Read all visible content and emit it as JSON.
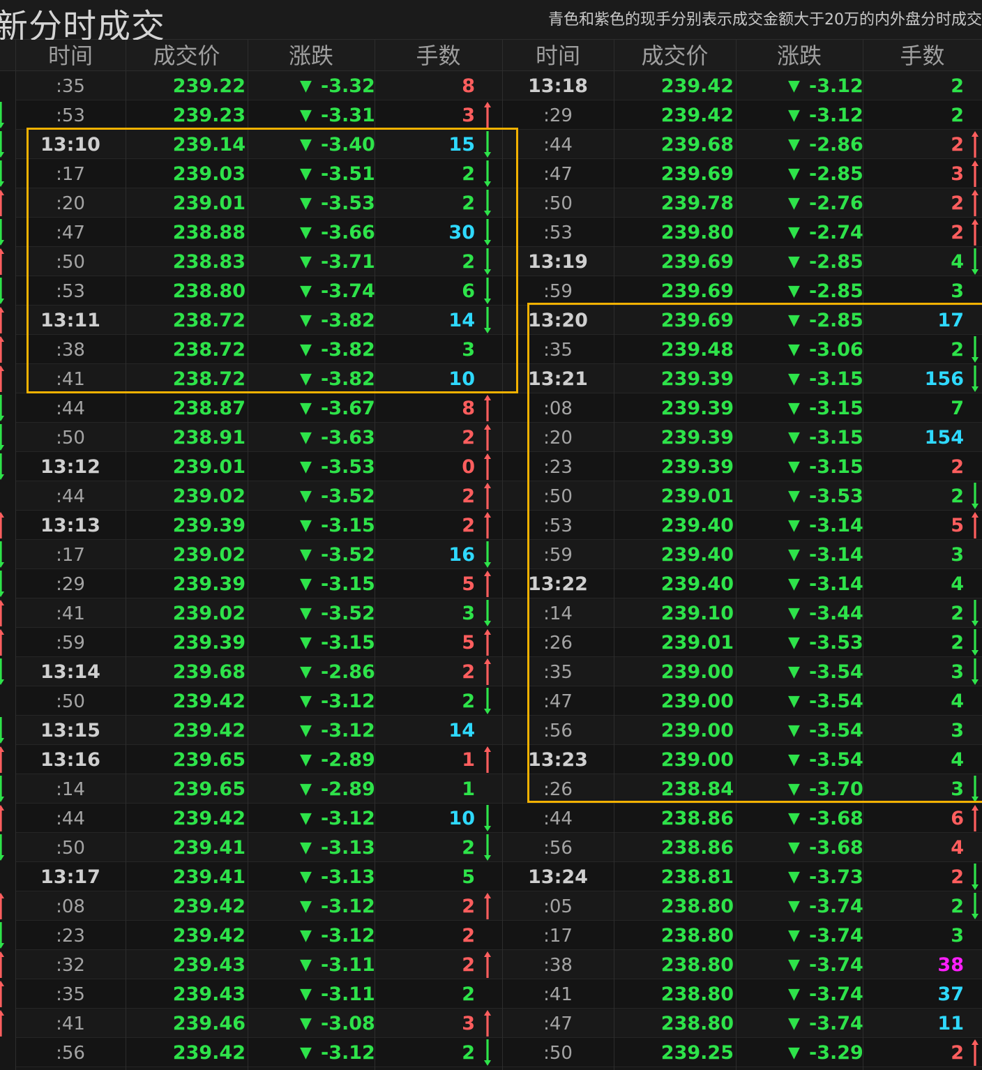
{
  "header": {
    "title": "新分时成交",
    "note": "青色和紫色的现手分别表示成交金额大于20万的内外盘分时成交"
  },
  "columns": [
    "时间",
    "成交价",
    "涨跌",
    "手数"
  ],
  "colors": {
    "price": "#2ee34a",
    "up": "#ff5e5e",
    "down": "#2ee34a",
    "large_buy": "#2fd9ff",
    "large_sell": "#ff1fff",
    "neutral": "#2ee34a",
    "highlight_box": "#f2b100"
  },
  "left_edge_markers": [
    "",
    "d",
    "d",
    "d",
    "u",
    "d",
    "u",
    "d",
    "u",
    "u",
    "u",
    "d",
    "d",
    "d",
    "",
    "u",
    "d",
    "d",
    "u",
    "u",
    "d",
    "",
    "d",
    "u",
    "d",
    "u",
    "d",
    "",
    "u",
    "d",
    "u",
    "u",
    "u",
    ""
  ],
  "left_rows": [
    {
      "time": ":35",
      "price": "239.22",
      "change": "-3.32",
      "volume": "8",
      "color": "up",
      "arrow": ""
    },
    {
      "time": ":53",
      "price": "239.23",
      "change": "-3.31",
      "volume": "3",
      "color": "up",
      "arrow": "up"
    },
    {
      "time": "13:10",
      "price": "239.14",
      "change": "-3.40",
      "volume": "15",
      "color": "large_buy",
      "arrow": "down"
    },
    {
      "time": ":17",
      "price": "239.03",
      "change": "-3.51",
      "volume": "2",
      "color": "down",
      "arrow": "down"
    },
    {
      "time": ":20",
      "price": "239.01",
      "change": "-3.53",
      "volume": "2",
      "color": "down",
      "arrow": "down"
    },
    {
      "time": ":47",
      "price": "238.88",
      "change": "-3.66",
      "volume": "30",
      "color": "large_buy",
      "arrow": "down"
    },
    {
      "time": ":50",
      "price": "238.83",
      "change": "-3.71",
      "volume": "2",
      "color": "down",
      "arrow": "down"
    },
    {
      "time": ":53",
      "price": "238.80",
      "change": "-3.74",
      "volume": "6",
      "color": "down",
      "arrow": "down"
    },
    {
      "time": "13:11",
      "price": "238.72",
      "change": "-3.82",
      "volume": "14",
      "color": "large_buy",
      "arrow": "down"
    },
    {
      "time": ":38",
      "price": "238.72",
      "change": "-3.82",
      "volume": "3",
      "color": "neutral",
      "arrow": ""
    },
    {
      "time": ":41",
      "price": "238.72",
      "change": "-3.82",
      "volume": "10",
      "color": "large_buy",
      "arrow": ""
    },
    {
      "time": ":44",
      "price": "238.87",
      "change": "-3.67",
      "volume": "8",
      "color": "up",
      "arrow": "up"
    },
    {
      "time": ":50",
      "price": "238.91",
      "change": "-3.63",
      "volume": "2",
      "color": "up",
      "arrow": "up"
    },
    {
      "time": "13:12",
      "price": "239.01",
      "change": "-3.53",
      "volume": "0",
      "color": "up",
      "arrow": "up"
    },
    {
      "time": ":44",
      "price": "239.02",
      "change": "-3.52",
      "volume": "2",
      "color": "up",
      "arrow": "up"
    },
    {
      "time": "13:13",
      "price": "239.39",
      "change": "-3.15",
      "volume": "2",
      "color": "up",
      "arrow": "up"
    },
    {
      "time": ":17",
      "price": "239.02",
      "change": "-3.52",
      "volume": "16",
      "color": "large_buy",
      "arrow": "down"
    },
    {
      "time": ":29",
      "price": "239.39",
      "change": "-3.15",
      "volume": "5",
      "color": "up",
      "arrow": "up"
    },
    {
      "time": ":41",
      "price": "239.02",
      "change": "-3.52",
      "volume": "3",
      "color": "down",
      "arrow": "down"
    },
    {
      "time": ":59",
      "price": "239.39",
      "change": "-3.15",
      "volume": "5",
      "color": "up",
      "arrow": "up"
    },
    {
      "time": "13:14",
      "price": "239.68",
      "change": "-2.86",
      "volume": "2",
      "color": "up",
      "arrow": "up"
    },
    {
      "time": ":50",
      "price": "239.42",
      "change": "-3.12",
      "volume": "2",
      "color": "down",
      "arrow": "down"
    },
    {
      "time": "13:15",
      "price": "239.42",
      "change": "-3.12",
      "volume": "14",
      "color": "large_buy",
      "arrow": ""
    },
    {
      "time": "13:16",
      "price": "239.65",
      "change": "-2.89",
      "volume": "1",
      "color": "up",
      "arrow": "up"
    },
    {
      "time": ":14",
      "price": "239.65",
      "change": "-2.89",
      "volume": "1",
      "color": "neutral",
      "arrow": ""
    },
    {
      "time": ":44",
      "price": "239.42",
      "change": "-3.12",
      "volume": "10",
      "color": "large_buy",
      "arrow": "down"
    },
    {
      "time": ":50",
      "price": "239.41",
      "change": "-3.13",
      "volume": "2",
      "color": "down",
      "arrow": "down"
    },
    {
      "time": "13:17",
      "price": "239.41",
      "change": "-3.13",
      "volume": "5",
      "color": "neutral",
      "arrow": ""
    },
    {
      "time": ":08",
      "price": "239.42",
      "change": "-3.12",
      "volume": "2",
      "color": "up",
      "arrow": "up"
    },
    {
      "time": ":23",
      "price": "239.42",
      "change": "-3.12",
      "volume": "2",
      "color": "up",
      "arrow": ""
    },
    {
      "time": ":32",
      "price": "239.43",
      "change": "-3.11",
      "volume": "2",
      "color": "up",
      "arrow": "up"
    },
    {
      "time": ":35",
      "price": "239.43",
      "change": "-3.11",
      "volume": "2",
      "color": "neutral",
      "arrow": ""
    },
    {
      "time": ":41",
      "price": "239.46",
      "change": "-3.08",
      "volume": "3",
      "color": "up",
      "arrow": "up"
    },
    {
      "time": ":56",
      "price": "239.42",
      "change": "-3.12",
      "volume": "2",
      "color": "down",
      "arrow": "down"
    }
  ],
  "right_rows": [
    {
      "time": "13:18",
      "price": "239.42",
      "change": "-3.12",
      "volume": "2",
      "color": "neutral",
      "arrow": ""
    },
    {
      "time": ":29",
      "price": "239.42",
      "change": "-3.12",
      "volume": "2",
      "color": "neutral",
      "arrow": ""
    },
    {
      "time": ":44",
      "price": "239.68",
      "change": "-2.86",
      "volume": "2",
      "color": "up",
      "arrow": "up"
    },
    {
      "time": ":47",
      "price": "239.69",
      "change": "-2.85",
      "volume": "3",
      "color": "up",
      "arrow": "up"
    },
    {
      "time": ":50",
      "price": "239.78",
      "change": "-2.76",
      "volume": "2",
      "color": "up",
      "arrow": "up"
    },
    {
      "time": ":53",
      "price": "239.80",
      "change": "-2.74",
      "volume": "2",
      "color": "up",
      "arrow": "up"
    },
    {
      "time": "13:19",
      "price": "239.69",
      "change": "-2.85",
      "volume": "4",
      "color": "down",
      "arrow": "down"
    },
    {
      "time": ":59",
      "price": "239.69",
      "change": "-2.85",
      "volume": "3",
      "color": "neutral",
      "arrow": ""
    },
    {
      "time": "13:20",
      "price": "239.69",
      "change": "-2.85",
      "volume": "17",
      "color": "large_buy",
      "arrow": ""
    },
    {
      "time": ":35",
      "price": "239.48",
      "change": "-3.06",
      "volume": "2",
      "color": "down",
      "arrow": "down"
    },
    {
      "time": "13:21",
      "price": "239.39",
      "change": "-3.15",
      "volume": "156",
      "color": "large_buy",
      "arrow": "down"
    },
    {
      "time": ":08",
      "price": "239.39",
      "change": "-3.15",
      "volume": "7",
      "color": "neutral",
      "arrow": ""
    },
    {
      "time": ":20",
      "price": "239.39",
      "change": "-3.15",
      "volume": "154",
      "color": "large_buy",
      "arrow": ""
    },
    {
      "time": ":23",
      "price": "239.39",
      "change": "-3.15",
      "volume": "2",
      "color": "up",
      "arrow": ""
    },
    {
      "time": ":50",
      "price": "239.01",
      "change": "-3.53",
      "volume": "2",
      "color": "down",
      "arrow": "down"
    },
    {
      "time": ":53",
      "price": "239.40",
      "change": "-3.14",
      "volume": "5",
      "color": "up",
      "arrow": "up"
    },
    {
      "time": ":59",
      "price": "239.40",
      "change": "-3.14",
      "volume": "3",
      "color": "neutral",
      "arrow": ""
    },
    {
      "time": "13:22",
      "price": "239.40",
      "change": "-3.14",
      "volume": "4",
      "color": "neutral",
      "arrow": ""
    },
    {
      "time": ":14",
      "price": "239.10",
      "change": "-3.44",
      "volume": "2",
      "color": "down",
      "arrow": "down"
    },
    {
      "time": ":26",
      "price": "239.01",
      "change": "-3.53",
      "volume": "2",
      "color": "down",
      "arrow": "down"
    },
    {
      "time": ":35",
      "price": "239.00",
      "change": "-3.54",
      "volume": "3",
      "color": "down",
      "arrow": "down"
    },
    {
      "time": ":47",
      "price": "239.00",
      "change": "-3.54",
      "volume": "4",
      "color": "neutral",
      "arrow": ""
    },
    {
      "time": ":56",
      "price": "239.00",
      "change": "-3.54",
      "volume": "3",
      "color": "neutral",
      "arrow": ""
    },
    {
      "time": "13:23",
      "price": "239.00",
      "change": "-3.54",
      "volume": "4",
      "color": "neutral",
      "arrow": ""
    },
    {
      "time": ":26",
      "price": "238.84",
      "change": "-3.70",
      "volume": "3",
      "color": "down",
      "arrow": "down"
    },
    {
      "time": ":44",
      "price": "238.86",
      "change": "-3.68",
      "volume": "6",
      "color": "up",
      "arrow": "up"
    },
    {
      "time": ":56",
      "price": "238.86",
      "change": "-3.68",
      "volume": "4",
      "color": "up",
      "arrow": ""
    },
    {
      "time": "13:24",
      "price": "238.81",
      "change": "-3.73",
      "volume": "2",
      "color": "up",
      "arrow": "down"
    },
    {
      "time": ":05",
      "price": "238.80",
      "change": "-3.74",
      "volume": "2",
      "color": "down",
      "arrow": "down"
    },
    {
      "time": ":17",
      "price": "238.80",
      "change": "-3.74",
      "volume": "3",
      "color": "neutral",
      "arrow": ""
    },
    {
      "time": ":38",
      "price": "238.80",
      "change": "-3.74",
      "volume": "38",
      "color": "large_sell",
      "arrow": ""
    },
    {
      "time": ":41",
      "price": "238.80",
      "change": "-3.74",
      "volume": "37",
      "color": "large_buy",
      "arrow": ""
    },
    {
      "time": ":47",
      "price": "238.80",
      "change": "-3.74",
      "volume": "11",
      "color": "large_buy",
      "arrow": ""
    },
    {
      "time": ":50",
      "price": "239.25",
      "change": "-3.29",
      "volume": "2",
      "color": "up",
      "arrow": "up"
    }
  ]
}
